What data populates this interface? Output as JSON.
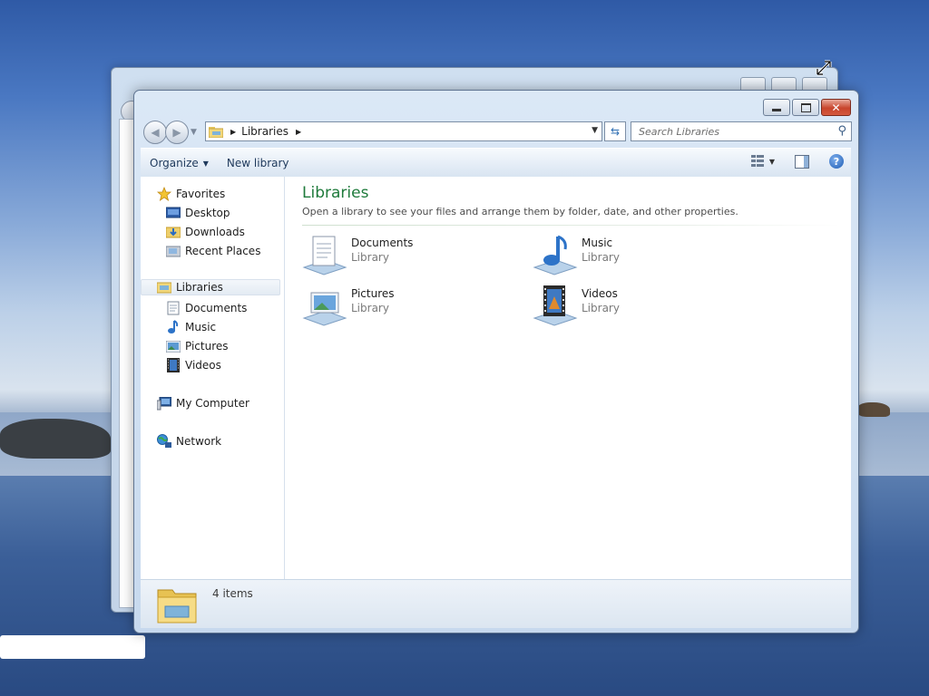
{
  "window": {
    "address": {
      "crumb": "Libraries"
    },
    "search": {
      "placeholder": "Search Libraries"
    },
    "toolbar": {
      "organize": "Organize",
      "new_library": "New library"
    },
    "nav": {
      "favorites": "Favorites",
      "favorite_items": [
        "Desktop",
        "Downloads",
        "Recent Places"
      ],
      "libraries": "Libraries",
      "library_items": [
        "Documents",
        "Music",
        "Pictures",
        "Videos"
      ],
      "computer": "My Computer",
      "network": "Network"
    },
    "main": {
      "title": "Libraries",
      "subtitle": "Open a library to see your files and arrange them by folder, date, and other properties.",
      "libraries": [
        {
          "name": "Documents",
          "type": "Library",
          "icon": "documents-library-icon"
        },
        {
          "name": "Music",
          "type": "Library",
          "icon": "music-library-icon"
        },
        {
          "name": "Pictures",
          "type": "Library",
          "icon": "pictures-library-icon"
        },
        {
          "name": "Videos",
          "type": "Library",
          "icon": "videos-library-icon"
        }
      ]
    },
    "status": {
      "count": "4 items"
    }
  },
  "colors": {
    "title_green": "#1e7a3b",
    "close_red": "#c8452c",
    "accent_blue": "#1e395b"
  }
}
